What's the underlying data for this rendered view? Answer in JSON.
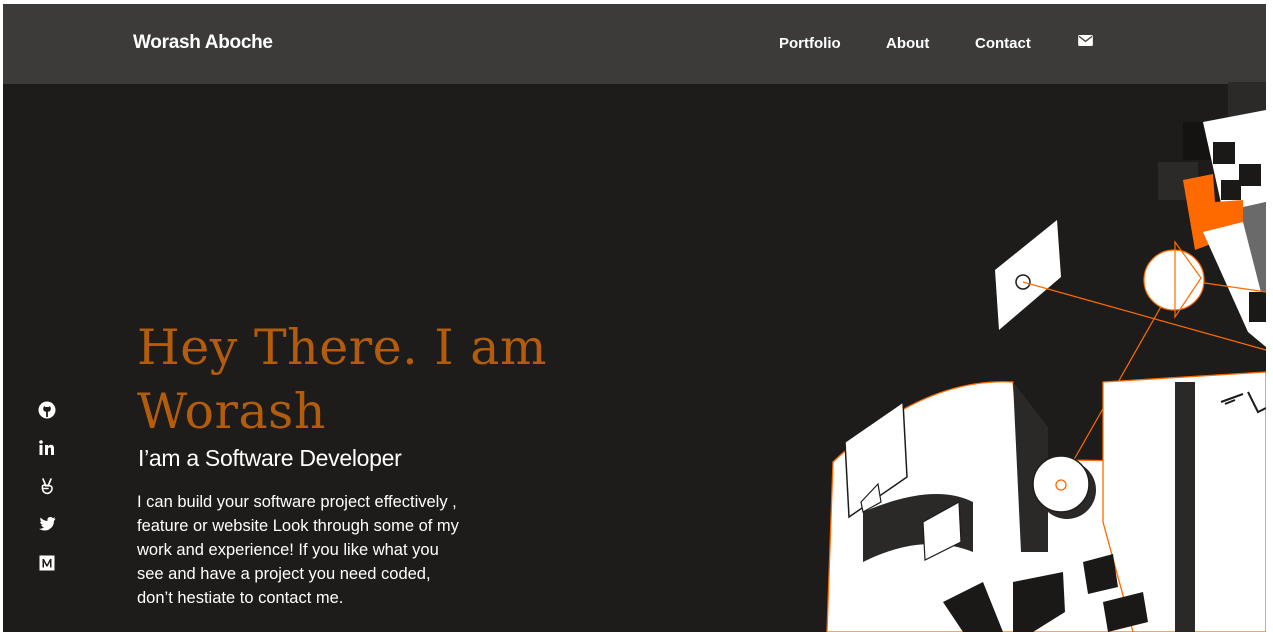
{
  "navbar": {
    "brand": "Worash Aboche",
    "links": [
      "Portfolio",
      "About",
      "Contact"
    ],
    "mail_icon": "envelope-icon"
  },
  "socials": [
    "github-icon",
    "linkedin-icon",
    "angellist-icon",
    "twitter-icon",
    "medium-icon"
  ],
  "hero": {
    "title": "Hey There. I am Worash",
    "subtitle": "I’am a Software Developer",
    "text": "I can build your software project effectively , feature or website Look through some of my work and experience! If you like what you see and have a project you need coded, don’t hestiate to contact me."
  },
  "colors": {
    "background": "#1e1c1a",
    "navbar": "#3c3b3a",
    "accent": "#b35d0c",
    "illustration_orange": "#ff6a00",
    "text": "#ffffff"
  }
}
